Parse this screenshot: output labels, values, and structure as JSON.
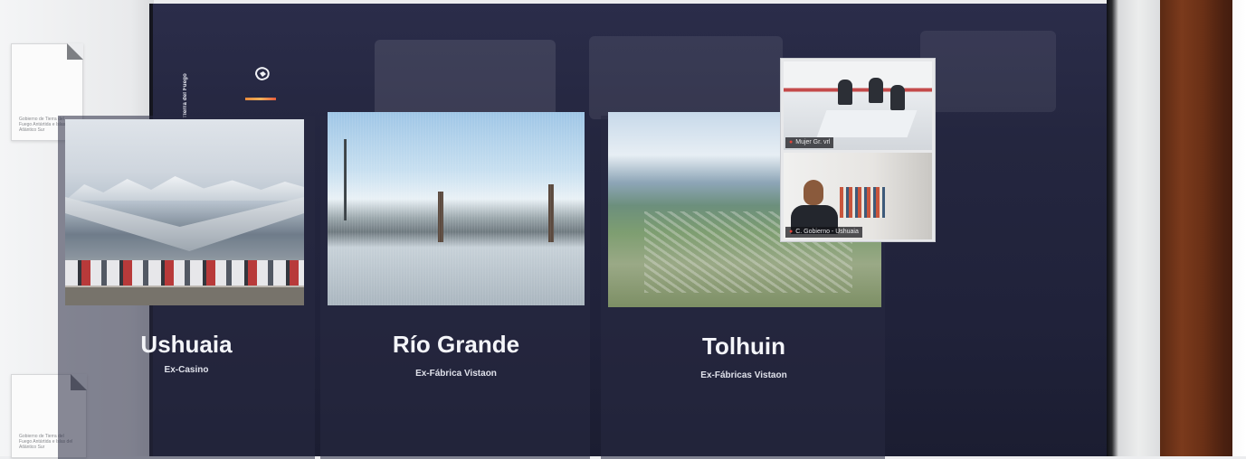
{
  "sidebar": {
    "vertical_text": "Gobierno / Gobierno de Tierra del Fuego"
  },
  "papers": [
    {
      "text": "Gobierno de Tierra del Fuego Antártida e Islas del Atlántico Sur"
    },
    {
      "text": "Gobierno de Tierra del Fuego Antártida e Islas del Atlántico Sur"
    }
  ],
  "cards": [
    {
      "title": "Ushuaia",
      "subtitle": "Ex-Casino"
    },
    {
      "title": "Río Grande",
      "subtitle": "Ex-Fábrica Vistaon"
    },
    {
      "title": "Tolhuin",
      "subtitle": "Ex-Fábricas Vistaon"
    }
  ],
  "video_call": {
    "participants": [
      {
        "name": "Mujer Gr. vrl"
      },
      {
        "name": "C. Gobierno - Ushuaia"
      }
    ]
  },
  "colors": {
    "screen_bg": "#23253d",
    "brand_bar": "#e88a3c",
    "wood": "#6a3016"
  }
}
